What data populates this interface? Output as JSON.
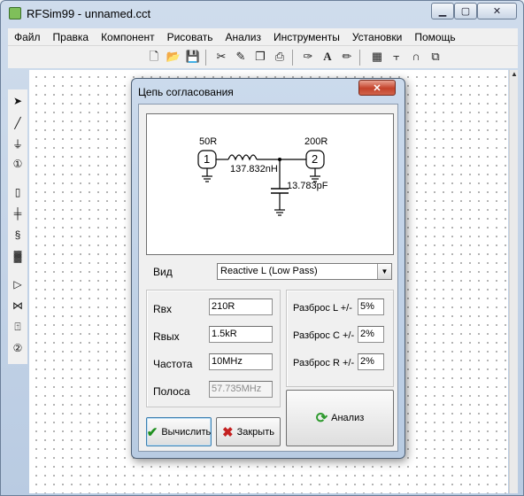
{
  "window": {
    "title": "RFSim99 - unnamed.cct"
  },
  "window_controls": {
    "minimize": "▁",
    "maximize": "▢",
    "close": "✕"
  },
  "menu": [
    "Файл",
    "Правка",
    "Компонент",
    "Рисовать",
    "Анализ",
    "Инструменты",
    "Установки",
    "Помощь"
  ],
  "toolbar_icons": [
    "new-file-icon",
    "open-folder-icon",
    "save-icon",
    "component-settings-icon",
    "component-edit-icon",
    "copy-icon",
    "print-icon",
    "wire-draw-icon",
    "text-icon",
    "pencil-icon",
    "calculator-icon",
    "transmission-line-icon",
    "coupler-icon",
    "s-param-icon"
  ],
  "palette_icons": [
    "pointer-icon",
    "line-icon",
    "ground-icon",
    "port-icon",
    "resistor-icon",
    "capacitor-icon",
    "inductor-icon",
    "transformer-icon",
    "amplifier-icon",
    "crystal-icon",
    "two-port-1-icon",
    "two-port-2-icon"
  ],
  "dialog": {
    "title": "Цепь согласования",
    "close": "✕",
    "schematic": {
      "source_impedance": "50R",
      "load_impedance": "200R",
      "port1": "1",
      "port2": "2",
      "inductor_value": "137.832nH",
      "capacitor_value": "13.783pF"
    },
    "type": {
      "label": "Вид",
      "value": "Reactive L  (Low Pass)",
      "arrow": "▼"
    },
    "fields": {
      "rin": {
        "label": "Rвх",
        "value": "210R"
      },
      "rout": {
        "label": "Rвых",
        "value": "1.5kR"
      },
      "freq": {
        "label": "Частота",
        "value": "10MHz"
      },
      "band": {
        "label": "Полоса",
        "value": "57.735MHz"
      }
    },
    "tolerances": {
      "l": {
        "label": "Разброс L +/-",
        "value": "5%"
      },
      "c": {
        "label": "Разброс C +/-",
        "value": "2%"
      },
      "r": {
        "label": "Разброс R +/-",
        "value": "2%"
      }
    },
    "buttons": {
      "calculate": "Вычислить",
      "close": "Закрыть",
      "analyze": "Анализ"
    }
  }
}
